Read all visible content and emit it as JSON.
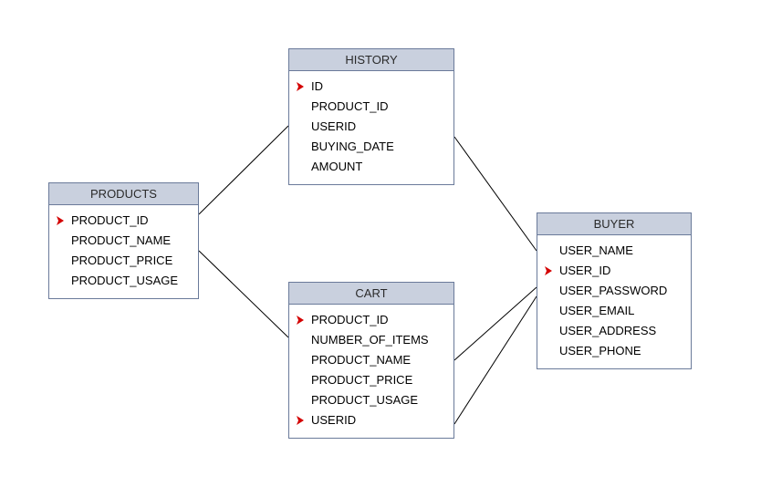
{
  "entities": {
    "products": {
      "title": "PRODUCTS",
      "fields": [
        {
          "name": "PRODUCT_ID",
          "key": true
        },
        {
          "name": "PRODUCT_NAME",
          "key": false
        },
        {
          "name": "PRODUCT_PRICE",
          "key": false
        },
        {
          "name": "PRODUCT_USAGE",
          "key": false
        }
      ]
    },
    "history": {
      "title": "HISTORY",
      "fields": [
        {
          "name": "ID",
          "key": true
        },
        {
          "name": "PRODUCT_ID",
          "key": false
        },
        {
          "name": "USERID",
          "key": false
        },
        {
          "name": "BUYING_DATE",
          "key": false
        },
        {
          "name": "AMOUNT",
          "key": false
        }
      ]
    },
    "cart": {
      "title": "CART",
      "fields": [
        {
          "name": "PRODUCT_ID",
          "key": true
        },
        {
          "name": "NUMBER_OF_ITEMS",
          "key": false
        },
        {
          "name": "PRODUCT_NAME",
          "key": false
        },
        {
          "name": "PRODUCT_PRICE",
          "key": false
        },
        {
          "name": "PRODUCT_USAGE",
          "key": false
        },
        {
          "name": "USERID",
          "key": true
        }
      ]
    },
    "buyer": {
      "title": "BUYER",
      "fields": [
        {
          "name": "USER_NAME",
          "key": false
        },
        {
          "name": "USER_ID",
          "key": true
        },
        {
          "name": "USER_PASSWORD",
          "key": false
        },
        {
          "name": "USER_EMAIL",
          "key": false
        },
        {
          "name": "USER_ADDRESS",
          "key": false
        },
        {
          "name": "USER_PHONE",
          "key": false
        }
      ]
    }
  },
  "relationships": [
    {
      "from": "products",
      "to": "history"
    },
    {
      "from": "products",
      "to": "cart"
    },
    {
      "from": "history",
      "to": "buyer"
    },
    {
      "from": "cart",
      "to": "buyer"
    }
  ]
}
